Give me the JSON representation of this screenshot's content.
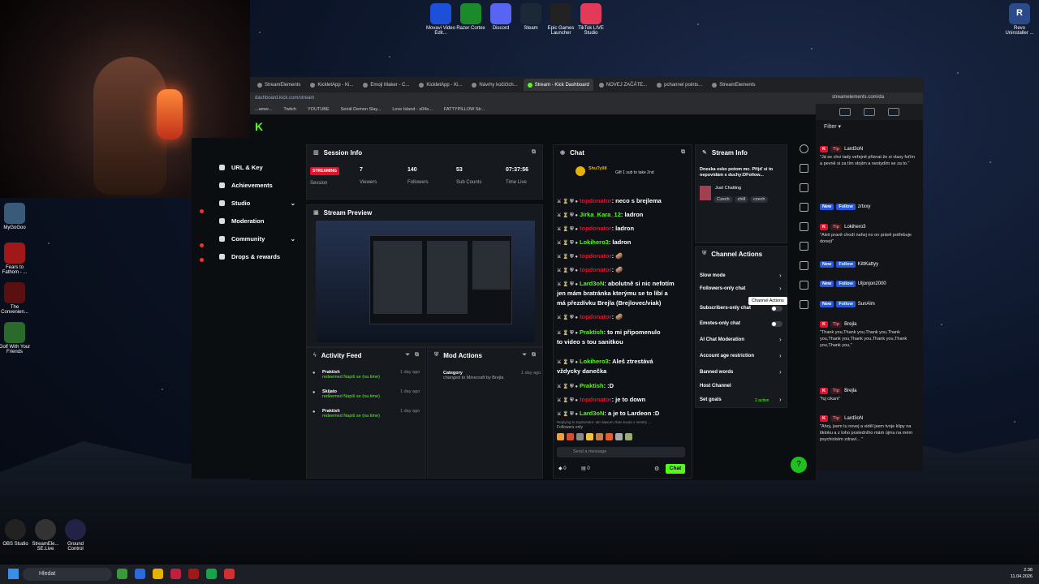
{
  "desktop_icons_top": [
    {
      "label": "Movavi Video Edit...",
      "icon": "film-icon",
      "color": "#1e4fd9"
    },
    {
      "label": "Razer Cortex",
      "icon": "razer-icon",
      "color": "#1a8a2a"
    },
    {
      "label": "Discord",
      "icon": "discord-icon",
      "color": "#5865f2"
    },
    {
      "label": "Steam",
      "icon": "steam-icon",
      "color": "#1b2838"
    },
    {
      "label": "Epic Games Launcher",
      "icon": "epic-icon",
      "color": "#222"
    },
    {
      "label": "TikTok LIVE Studio",
      "icon": "tiktok-icon",
      "color": "#e33a5a"
    }
  ],
  "desktop_icons_left": [
    {
      "label": "MyGoGoo",
      "color": "#3a5a7a"
    },
    {
      "label": "Fears to Fathom - ...",
      "color": "#a01818"
    },
    {
      "label": "The Convenien...",
      "color": "#5a1010"
    },
    {
      "label": "Golf With Your Friends",
      "color": "#2a6a2a"
    }
  ],
  "desktop_icons_bottom": [
    {
      "label": "OBS Studio",
      "color": "#222"
    },
    {
      "label": "StreamEle... SE.Live",
      "color": "#333"
    },
    {
      "label": "Ground Control",
      "color": "#224"
    }
  ],
  "desktop_icon_right": {
    "label": "Revo Uninstaller ..."
  },
  "browser": {
    "tabs": [
      "StreamElements",
      "KickletApp - Ki...",
      "Emoji Maker - C...",
      "KickletApp - Ki...",
      "Návrhy kočičích...",
      "Stream - Kick Dashboard",
      "NOVEJ ZAČÁTE...",
      "pchannel points...",
      "StreamElements"
    ],
    "active_tab_index": 5,
    "url": "dashboard.kick.com/stream",
    "bookmarks": [
      "...amer...",
      "Twitch",
      "YOUTUBE",
      "Seriál Demon Slay...",
      "Love Island - s04e...",
      "FATTYPILLOW Str..."
    ]
  },
  "sidebar": {
    "items": [
      {
        "label": "URL & Key"
      },
      {
        "label": "Achievements"
      },
      {
        "label": "Studio",
        "chevron": true
      },
      {
        "label": "Moderation"
      },
      {
        "label": "Community",
        "chevron": true
      },
      {
        "label": "Drops & rewards"
      }
    ]
  },
  "session_info": {
    "title": "Session Info",
    "badge": "STREAMING",
    "stats": [
      {
        "value": "",
        "label": "Session"
      },
      {
        "value": "7",
        "label": "Viewers"
      },
      {
        "value": "140",
        "label": "Followers"
      },
      {
        "value": "53",
        "label": "Sub Counts"
      },
      {
        "value": "07:37:56",
        "label": "Time Live"
      }
    ]
  },
  "stream_preview": {
    "title": "Stream Preview"
  },
  "activity_feed": {
    "title": "Activity Feed",
    "items": [
      {
        "user": "Praktish",
        "action": "redeemed Napiš se (na time)",
        "time": "1 day ago"
      },
      {
        "user": "Skijato",
        "action": "redeemed Napiš se (na time)",
        "time": "1 day ago"
      },
      {
        "user": "Praktish",
        "action": "redeemed Napiš se (na time)",
        "time": "1 day ago"
      }
    ]
  },
  "mod_actions": {
    "title": "Mod Actions",
    "items": [
      {
        "title": "Category",
        "detail": "changed to Minecraft by Brejla",
        "time": "1 day ago"
      }
    ]
  },
  "chat": {
    "title": "Chat",
    "pinned": {
      "user": "ShuTy98",
      "text": "Gift 1 sub to take 2nd"
    },
    "messages": [
      {
        "user": "topdonator",
        "text": ": neco s brejlema",
        "color": "red"
      },
      {
        "user": "Jirka_Kara_12",
        "text": ": ladron",
        "color": "green"
      },
      {
        "user": "topdonator",
        "text": ": ladron",
        "color": "red"
      },
      {
        "user": "Lokihero3",
        "text": ": ladron",
        "color": "green"
      },
      {
        "user": "topdonator",
        "text": ": 🥔",
        "color": "red"
      },
      {
        "user": "topdonator",
        "text": ": 🥔",
        "color": "red"
      },
      {
        "user": "Lard3oN",
        "text": ": abolutně si nic nefotím",
        "color": "green"
      },
      {
        "user": "",
        "text": "jen mám bratránka kterýmu se to líbí a",
        "color": "white"
      },
      {
        "user": "",
        "text": "má přezdívku Brejla (Brejlovec/viak)",
        "color": "white"
      },
      {
        "user": "topdonator",
        "text": ": 🥔",
        "color": "red"
      },
      {
        "user": "Praktish",
        "text": ": to mi připomenulo",
        "color": "green"
      },
      {
        "user": "",
        "text": "to video s tou sanitkou",
        "color": "white"
      },
      {
        "user": "Lokihero3",
        "text": ": Aleš ztrestává",
        "color": "green"
      },
      {
        "user": "",
        "text": "vždycky danečka",
        "color": "white"
      },
      {
        "user": "Praktish",
        "text": ": :D",
        "color": "green"
      },
      {
        "user": "topdonator",
        "text": ": je to down",
        "color": "red"
      },
      {
        "user": "Lard3oN",
        "text": ": a je to Lardeon :D",
        "color": "green"
      }
    ],
    "reply_note": "Replying to topdonator: ale daacen zlato kouta s mestry ...",
    "followers_only": "Followers only",
    "send_placeholder": "Send a message",
    "points": "0",
    "send_button": "Chat"
  },
  "stream_info": {
    "title": "Stream Info",
    "description": "Dneska esko potom mc. Přijď si to nepovidám s duchy:DFollow...",
    "category": "Just Chatting",
    "tags": [
      "Czech",
      "chill",
      "czech"
    ]
  },
  "channel_actions": {
    "title": "Channel Actions",
    "rows": [
      {
        "label": "Slow mode",
        "control": "chevron"
      },
      {
        "label": "Followers-only chat",
        "control": "chevron"
      },
      {
        "label": "Subscribers-only chat",
        "control": "toggle"
      },
      {
        "label": "Emotes-only chat",
        "control": "toggle"
      },
      {
        "label": "AI Chat Moderation",
        "control": "chevron"
      },
      {
        "label": "Account age restriction",
        "control": "chevron"
      },
      {
        "label": "Banned words",
        "control": "chevron"
      },
      {
        "label": "Host Channel",
        "control": "none"
      },
      {
        "label": "Set goals",
        "control": "chevron",
        "extra": "2 active"
      }
    ],
    "tooltip": "Channel Actions"
  },
  "streamelements": {
    "url": "streamelements.com/da",
    "filter": "Filter",
    "events": [
      {
        "type": "tip",
        "user": "Lard3oN",
        "text": "\"Já se chci tady veřejně přiznat že si vlasy foťím a pevně si za tím stojím a nestydím se za to.\""
      },
      {
        "type": "follow",
        "user": "zrtxxy",
        "text": ""
      },
      {
        "type": "tip",
        "user": "Lokihero3",
        "text": "\"Aleš pravě chodí nahej no on právě potřebuje donejt\""
      },
      {
        "type": "follow",
        "user": "KittKattyy",
        "text": ""
      },
      {
        "type": "follow",
        "user": "Uljonjon2000",
        "text": ""
      },
      {
        "type": "follow",
        "user": "SunAlm",
        "text": ""
      },
      {
        "type": "tip",
        "user": "Brejla",
        "text": "\"Thank you,Thank you,Thank you,Thank you,Thank you,Thank you,Thank you,Thank you,Thank you,\""
      },
      {
        "type": "tip",
        "user": "Brejla",
        "text": "\"fuj cikani\""
      },
      {
        "type": "tip",
        "user": "Lard3oN",
        "text": "\"Ahoj, jsem tu novej a viděl jsem tvoje klipy na tiktoku a z toho posledního mám újmu na mém psychickém zdraví... \""
      }
    ]
  },
  "taskbar": {
    "search": "Hledat",
    "time": "2:38",
    "date": "11.04.2026"
  },
  "colors": {
    "kick_green": "#53fc18",
    "live_red": "#e3122b",
    "panel": "#161a1f"
  }
}
